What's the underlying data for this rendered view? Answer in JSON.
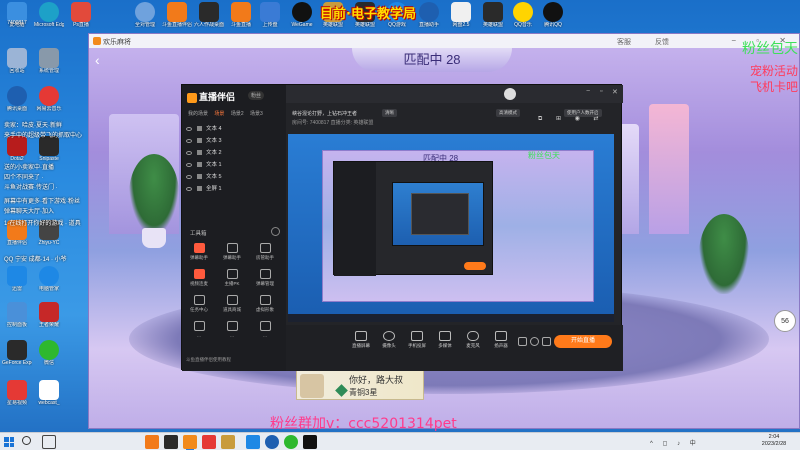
{
  "banner_top": "目前·电子教学局",
  "desktop_top_icons": [
    {
      "label": "此电脑",
      "color": "#3b8fe0"
    },
    {
      "label": "Microsoft Edge",
      "color": "#1da1c8"
    },
    {
      "label": "Ps直播",
      "color": "#e24a3b"
    },
    {
      "label": "全对管理",
      "color": "#6fa2dd"
    },
    {
      "label": "斗鱼直播伴侣",
      "color": "#f27a1a"
    },
    {
      "label": "六人作战桌面",
      "color": "#2a2a2a"
    },
    {
      "label": "斗鱼直播",
      "color": "#f27a1a"
    },
    {
      "label": "上传盘",
      "color": "#3a7bd5"
    },
    {
      "label": "WeGame",
      "color": "#111111"
    },
    {
      "label": "英雄联盟",
      "color": "#c89b3c"
    },
    {
      "label": "英雄联盟",
      "color": "#2a2a2a"
    },
    {
      "label": "QQ游戏",
      "color": "#1e88e5"
    },
    {
      "label": "直播助手",
      "color": "#f0f0f0"
    },
    {
      "label": "网盘2.5",
      "color": "#6ab0ff"
    },
    {
      "label": "英雄联盟",
      "color": "#2a2a2a"
    },
    {
      "label": "QQ音乐",
      "color": "#ffd400"
    },
    {
      "label": "腾讯QQ",
      "color": "#111111"
    }
  ],
  "desktop_left_icons": [
    {
      "label": "7400817",
      "color": "#3a78c9"
    },
    {
      "label": "回收站",
      "color": "#9bb4d6"
    },
    {
      "label": "系统管理",
      "color": "#8899aa"
    },
    {
      "label": "腾讯桌面",
      "color": "#e53935"
    },
    {
      "label": "多人桌面",
      "color": "#2a8be0"
    },
    {
      "label": "网易云音乐",
      "color": "#e53935"
    },
    {
      "label": "Dota2",
      "color": "#b71c1c"
    },
    {
      "label": "Snipaste",
      "color": "#2a2a2a"
    },
    {
      "label": "直播伴侣",
      "color": "#f27a1a"
    },
    {
      "label": "Zhiyu-YC",
      "color": "#444444"
    },
    {
      "label": "迅雷",
      "color": "#1e88e5"
    },
    {
      "label": "电脑管家",
      "color": "#1e88e5"
    },
    {
      "label": "控制面板",
      "color": "#4a90d9"
    },
    {
      "label": "王者荣耀",
      "color": "#c62828"
    },
    {
      "label": "GeForce Experience",
      "color": "#2a2a2a"
    },
    {
      "label": "微信",
      "color": "#2eb82e"
    },
    {
      "label": "星易视频",
      "color": "#e53935"
    },
    {
      "label": "webcast_",
      "color": "#ffffff"
    }
  ],
  "desktop_overlay_texts": [
    "卖家：哈皮·夏天·新鲜",
    "来手中的超级带飞的抓取中心",
    "送的小卖家中·直播",
    "四个不同来了 ·",
    "斗鱼对战赛·传送门 ·",
    "屏幕中有更多·看下游戏·粉丝",
    "弹幕聊天大厅·加入",
    "1·在线打开你好的游戏 · 道具",
    "QQ 宁安 成都·14 · 小爷"
  ],
  "game_window": {
    "title": "欢乐麻将",
    "title_right": [
      "客服",
      "反馈"
    ],
    "match_text": "匹配中 28",
    "timer": "56"
  },
  "promo_right": [
    {
      "text": "粉丝包天",
      "style": "green"
    },
    {
      "text": "宠粉活动",
      "style": "red"
    },
    {
      "text": "飞机卡吧",
      "style": "red"
    }
  ],
  "player_card": {
    "name": "你好，路大叔",
    "rank": "青铜3星"
  },
  "fan_text": "粉丝群加v：ccc5201314pet",
  "stream_app": {
    "logo": "直播伴侣",
    "badge": "粉丝",
    "scene_tabs": [
      {
        "label": "我的场景",
        "active": false
      },
      {
        "label": "场景",
        "active": true
      },
      {
        "label": "场景2",
        "active": false
      },
      {
        "label": "场景3",
        "active": false
      }
    ],
    "sources": [
      {
        "label": "文本 4"
      },
      {
        "label": "文本 3"
      },
      {
        "label": "文本 2"
      },
      {
        "label": "文本 1"
      },
      {
        "label": "文本 5"
      },
      {
        "label": "全屏 1"
      }
    ],
    "tools_label": "工具箱",
    "tools": [
      {
        "label": "弹幕助手",
        "hot": true
      },
      {
        "label": "弹幕助手",
        "hot": false
      },
      {
        "label": "房管助手",
        "hot": false
      },
      {
        "label": "视频连麦",
        "hot": true
      },
      {
        "label": "主播PK",
        "hot": false
      },
      {
        "label": "弹幕管理",
        "hot": false
      },
      {
        "label": "任务中心",
        "hot": false
      },
      {
        "label": "道具商城",
        "hot": false
      },
      {
        "label": "虚拟形象",
        "hot": false
      },
      {
        "label": "...",
        "hot": false
      },
      {
        "label": "...",
        "hot": false
      },
      {
        "label": "...",
        "hot": false
      }
    ],
    "bottom_notice": "斗鱼直播伴侣使用教程",
    "info_line1": "峡谷混论打野，上钻石冲王者",
    "info_line2": "房间号: 7400817  直播分类: 英雄联盟",
    "mode_box1": "清晰",
    "mode_box2": "高清模式",
    "mode_box3": "使用户人数开启",
    "controls": [
      {
        "label": "直播屏幕"
      },
      {
        "label": "摄像头"
      },
      {
        "label": "手机投屏"
      },
      {
        "label": "多媒体"
      },
      {
        "label": "麦克风"
      },
      {
        "label": "扬声器"
      }
    ],
    "live_button": "开始直播"
  },
  "taskbar": {
    "time": "2:04",
    "date": "2023/2/28",
    "tray": "^ ◻ ♪ 中"
  }
}
